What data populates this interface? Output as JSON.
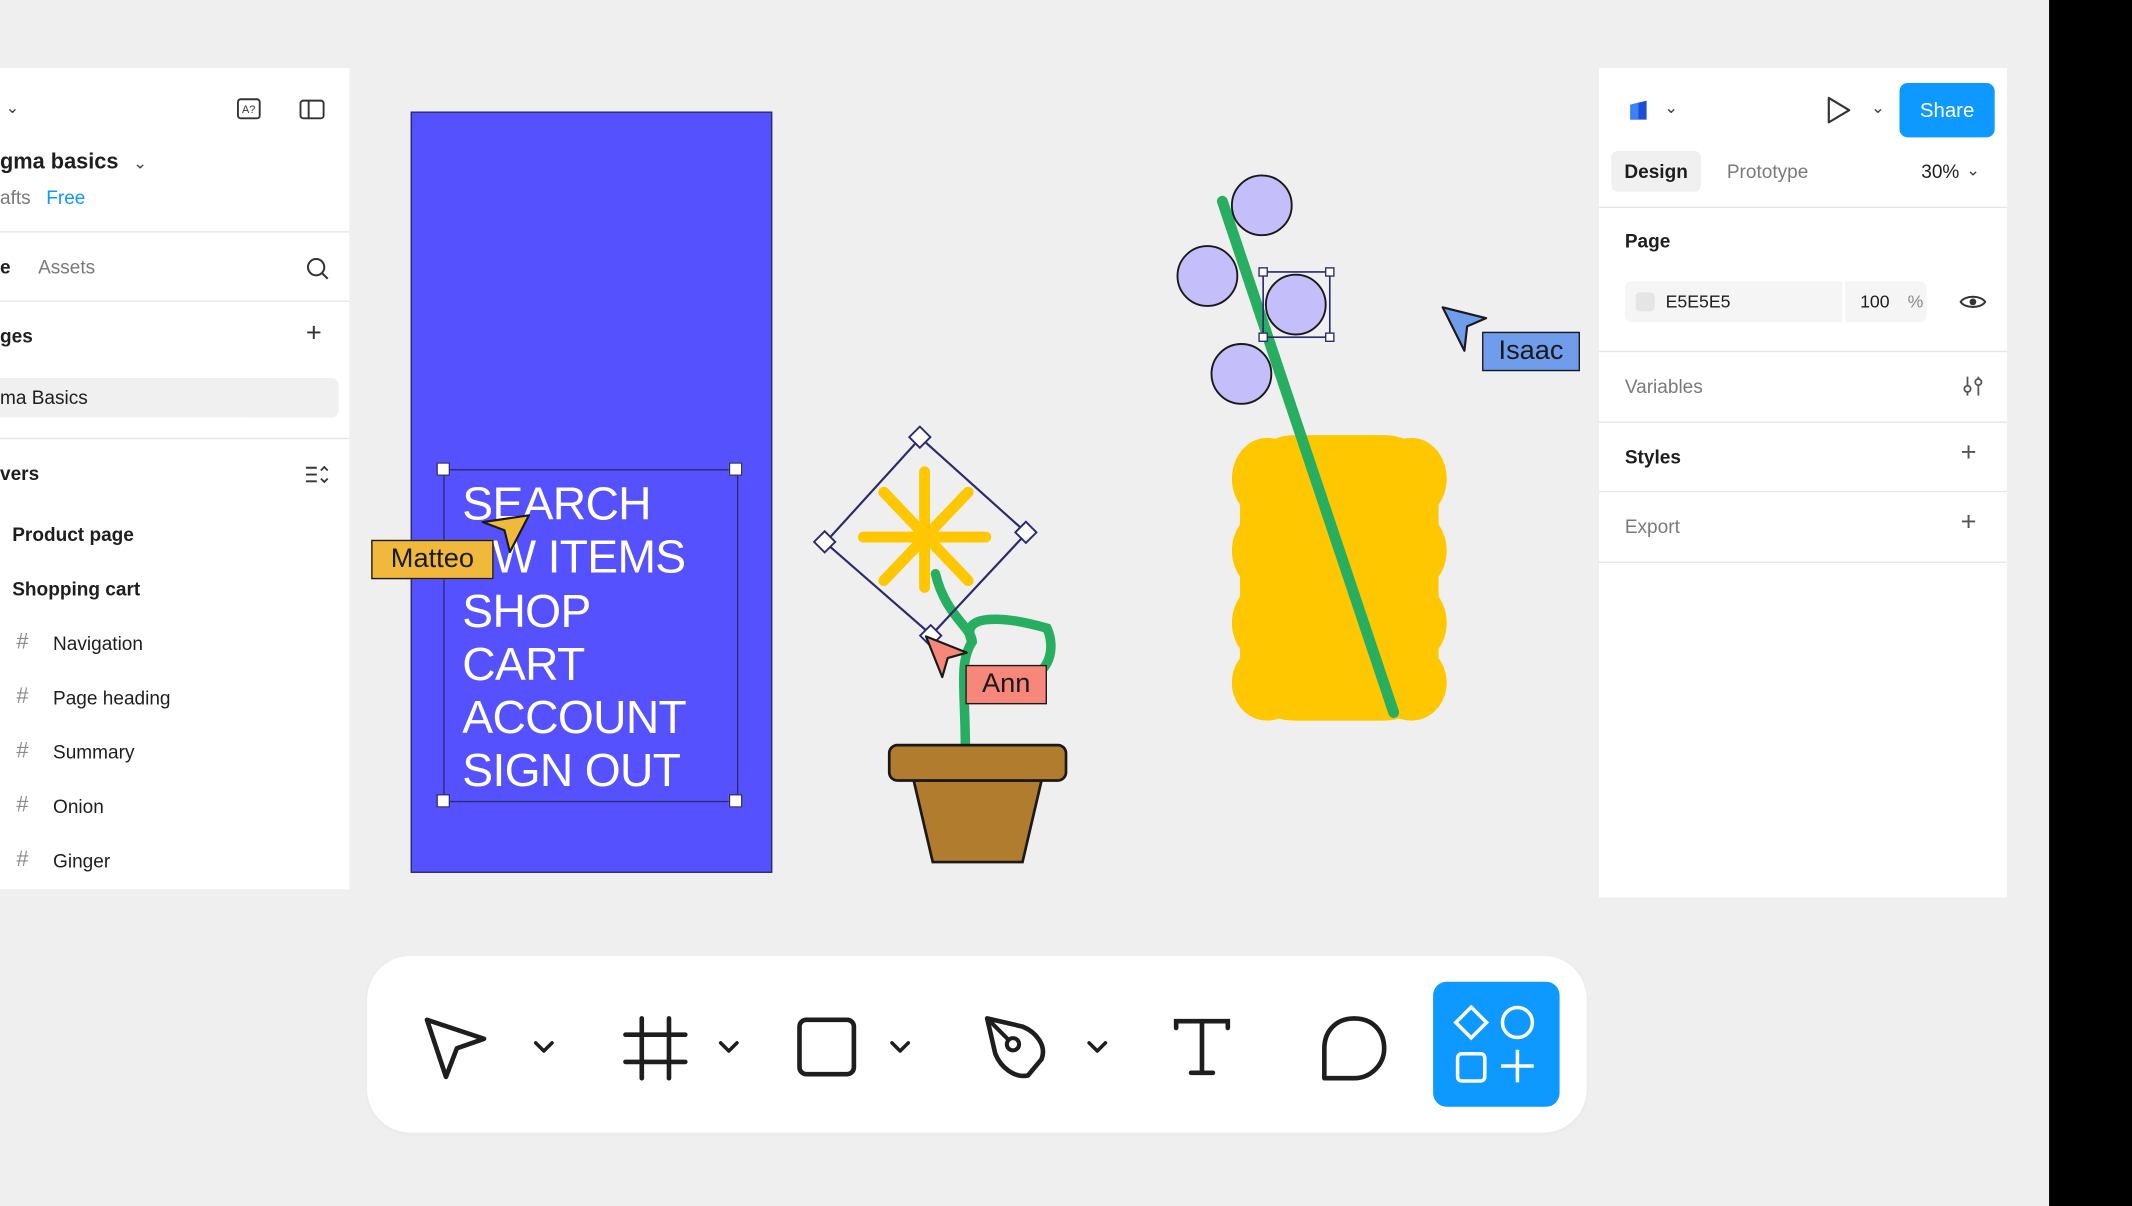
{
  "file": {
    "name": "gma basics",
    "drafts": "afts",
    "plan": "Free"
  },
  "left_tabs": {
    "file": "e",
    "assets": "Assets"
  },
  "pages": {
    "header": "ges",
    "items": [
      "ma Basics"
    ]
  },
  "layers": {
    "header": "vers",
    "items": [
      "Product page",
      "Shopping cart",
      "Navigation",
      "Page heading",
      "Summary",
      "Onion",
      "Ginger"
    ]
  },
  "canvas": {
    "menu_lines": [
      "SEARCH",
      "EW ITEMS",
      "SHOP",
      "CART",
      "ACCOUNT",
      "SIGN OUT"
    ],
    "cursors": [
      {
        "name": "Matteo",
        "color": "#f0b93c"
      },
      {
        "name": "Ann",
        "color": "#f6877a"
      },
      {
        "name": "Isaac",
        "color": "#6f9ceb"
      }
    ],
    "colors": {
      "phone": "#5551ff",
      "vase": "#ffc700",
      "stem": "#27ae60",
      "berries": "#c4bffa",
      "pot": "#b27c2e",
      "flower": "#ffc700"
    }
  },
  "right_panel": {
    "share": "Share",
    "tabs": {
      "design": "Design",
      "prototype": "Prototype"
    },
    "zoom": "30%",
    "page_section": "Page",
    "page_color": "E5E5E5",
    "page_opacity": "100",
    "percent": "%",
    "variables": "Variables",
    "styles": "Styles",
    "export": "Export"
  },
  "toolbar": {
    "tools": [
      "move-tool",
      "frame-tool",
      "shape-tool",
      "pen-tool",
      "text-tool",
      "comment-tool",
      "actions-tool"
    ],
    "accent": "#0d99ff"
  }
}
